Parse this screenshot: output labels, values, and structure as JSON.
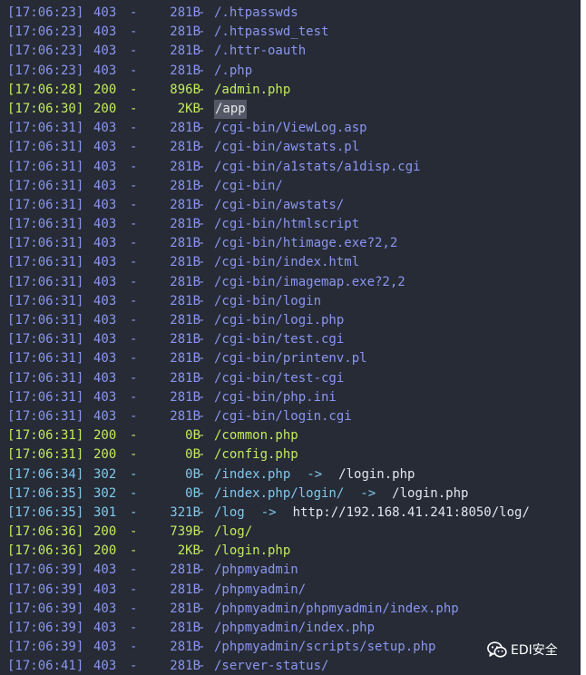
{
  "watermark": {
    "text": "EDI安全",
    "icon": "wechat-icon"
  },
  "colors": {
    "background": "#262b36",
    "status_403": "#8b95ee",
    "status_200": "#c4ea5d",
    "status_30x": "#82c8ec",
    "redirect_target": "#e3e6ee",
    "highlight": "#545866"
  },
  "lines": [
    {
      "time": "[17:06:23]",
      "code": "403",
      "size": "281B",
      "path": "/.htpasswds"
    },
    {
      "time": "[17:06:23]",
      "code": "403",
      "size": "281B",
      "path": "/.htpasswd_test"
    },
    {
      "time": "[17:06:23]",
      "code": "403",
      "size": "281B",
      "path": "/.httr-oauth"
    },
    {
      "time": "[17:06:23]",
      "code": "403",
      "size": "281B",
      "path": "/.php"
    },
    {
      "time": "[17:06:28]",
      "code": "200",
      "size": "896B",
      "path": "/admin.php"
    },
    {
      "time": "[17:06:30]",
      "code": "200",
      "size": "2KB",
      "path": "/app",
      "highlight": true
    },
    {
      "time": "[17:06:31]",
      "code": "403",
      "size": "281B",
      "path": "/cgi-bin/ViewLog.asp"
    },
    {
      "time": "[17:06:31]",
      "code": "403",
      "size": "281B",
      "path": "/cgi-bin/awstats.pl"
    },
    {
      "time": "[17:06:31]",
      "code": "403",
      "size": "281B",
      "path": "/cgi-bin/a1stats/a1disp.cgi"
    },
    {
      "time": "[17:06:31]",
      "code": "403",
      "size": "281B",
      "path": "/cgi-bin/"
    },
    {
      "time": "[17:06:31]",
      "code": "403",
      "size": "281B",
      "path": "/cgi-bin/awstats/"
    },
    {
      "time": "[17:06:31]",
      "code": "403",
      "size": "281B",
      "path": "/cgi-bin/htmlscript"
    },
    {
      "time": "[17:06:31]",
      "code": "403",
      "size": "281B",
      "path": "/cgi-bin/htimage.exe?2,2"
    },
    {
      "time": "[17:06:31]",
      "code": "403",
      "size": "281B",
      "path": "/cgi-bin/index.html"
    },
    {
      "time": "[17:06:31]",
      "code": "403",
      "size": "281B",
      "path": "/cgi-bin/imagemap.exe?2,2"
    },
    {
      "time": "[17:06:31]",
      "code": "403",
      "size": "281B",
      "path": "/cgi-bin/login"
    },
    {
      "time": "[17:06:31]",
      "code": "403",
      "size": "281B",
      "path": "/cgi-bin/logi.php"
    },
    {
      "time": "[17:06:31]",
      "code": "403",
      "size": "281B",
      "path": "/cgi-bin/test.cgi"
    },
    {
      "time": "[17:06:31]",
      "code": "403",
      "size": "281B",
      "path": "/cgi-bin/printenv.pl"
    },
    {
      "time": "[17:06:31]",
      "code": "403",
      "size": "281B",
      "path": "/cgi-bin/test-cgi"
    },
    {
      "time": "[17:06:31]",
      "code": "403",
      "size": "281B",
      "path": "/cgi-bin/php.ini"
    },
    {
      "time": "[17:06:31]",
      "code": "403",
      "size": "281B",
      "path": "/cgi-bin/login.cgi"
    },
    {
      "time": "[17:06:31]",
      "code": "200",
      "size": "0B",
      "path": "/common.php"
    },
    {
      "time": "[17:06:31]",
      "code": "200",
      "size": "0B",
      "path": "/config.php"
    },
    {
      "time": "[17:06:34]",
      "code": "302",
      "size": "0B",
      "path": "/index.php",
      "arrow": "->",
      "target": "/login.php"
    },
    {
      "time": "[17:06:35]",
      "code": "302",
      "size": "0B",
      "path": "/index.php/login/",
      "arrow": "->",
      "target": "/login.php"
    },
    {
      "time": "[17:06:35]",
      "code": "301",
      "size": "321B",
      "path": "/log",
      "arrow": "->",
      "target": "http://192.168.41.241:8050/log/"
    },
    {
      "time": "[17:06:36]",
      "code": "200",
      "size": "739B",
      "path": "/log/"
    },
    {
      "time": "[17:06:36]",
      "code": "200",
      "size": "2KB",
      "path": "/login.php"
    },
    {
      "time": "[17:06:39]",
      "code": "403",
      "size": "281B",
      "path": "/phpmyadmin"
    },
    {
      "time": "[17:06:39]",
      "code": "403",
      "size": "281B",
      "path": "/phpmyadmin/"
    },
    {
      "time": "[17:06:39]",
      "code": "403",
      "size": "281B",
      "path": "/phpmyadmin/phpmyadmin/index.php"
    },
    {
      "time": "[17:06:39]",
      "code": "403",
      "size": "281B",
      "path": "/phpmyadmin/index.php"
    },
    {
      "time": "[17:06:39]",
      "code": "403",
      "size": "281B",
      "path": "/phpmyadmin/scripts/setup.php"
    },
    {
      "time": "[17:06:41]",
      "code": "403",
      "size": "281B",
      "path": "/server-status/"
    }
  ]
}
